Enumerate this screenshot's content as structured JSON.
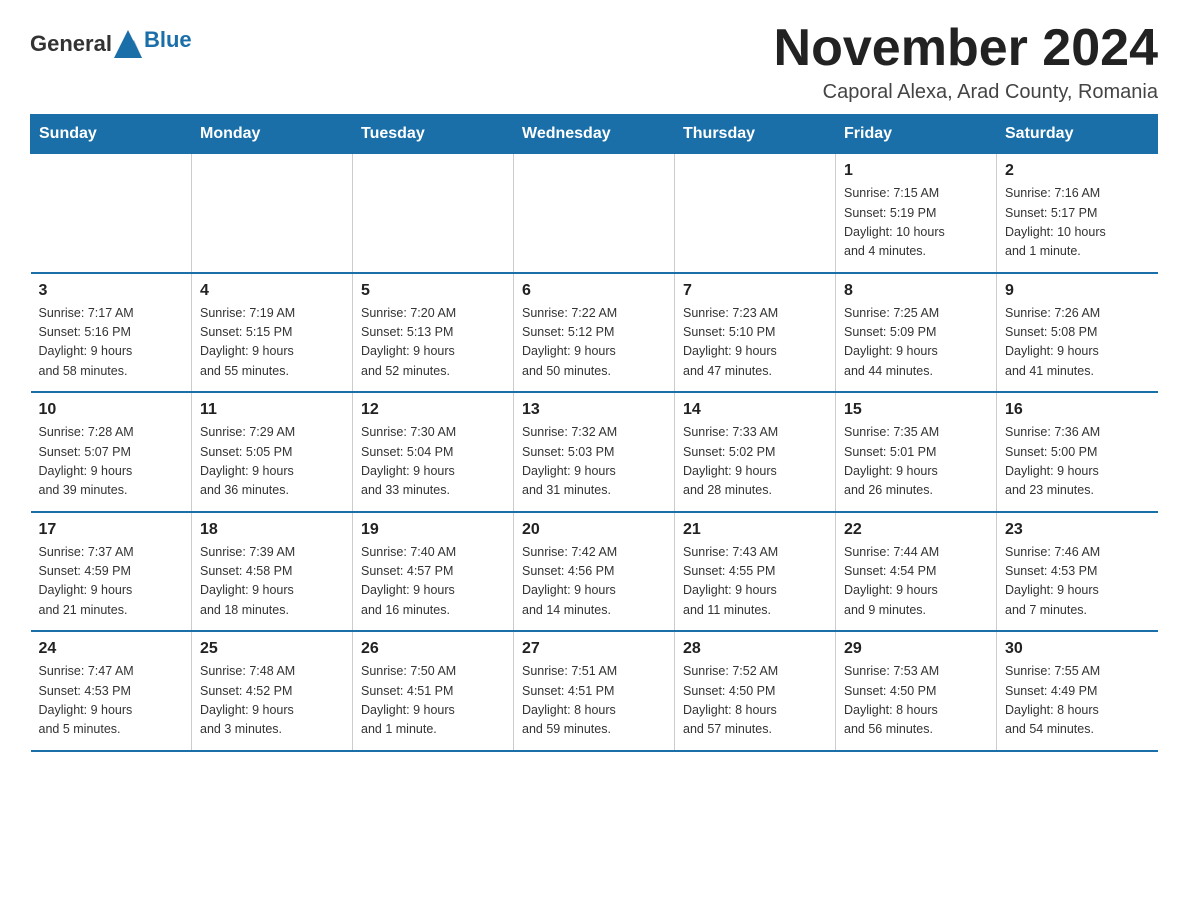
{
  "header": {
    "logo_general": "General",
    "logo_blue": "Blue",
    "month_title": "November 2024",
    "location": "Caporal Alexa, Arad County, Romania"
  },
  "weekdays": [
    "Sunday",
    "Monday",
    "Tuesday",
    "Wednesday",
    "Thursday",
    "Friday",
    "Saturday"
  ],
  "weeks": [
    [
      {
        "day": "",
        "info": ""
      },
      {
        "day": "",
        "info": ""
      },
      {
        "day": "",
        "info": ""
      },
      {
        "day": "",
        "info": ""
      },
      {
        "day": "",
        "info": ""
      },
      {
        "day": "1",
        "info": "Sunrise: 7:15 AM\nSunset: 5:19 PM\nDaylight: 10 hours\nand 4 minutes."
      },
      {
        "day": "2",
        "info": "Sunrise: 7:16 AM\nSunset: 5:17 PM\nDaylight: 10 hours\nand 1 minute."
      }
    ],
    [
      {
        "day": "3",
        "info": "Sunrise: 7:17 AM\nSunset: 5:16 PM\nDaylight: 9 hours\nand 58 minutes."
      },
      {
        "day": "4",
        "info": "Sunrise: 7:19 AM\nSunset: 5:15 PM\nDaylight: 9 hours\nand 55 minutes."
      },
      {
        "day": "5",
        "info": "Sunrise: 7:20 AM\nSunset: 5:13 PM\nDaylight: 9 hours\nand 52 minutes."
      },
      {
        "day": "6",
        "info": "Sunrise: 7:22 AM\nSunset: 5:12 PM\nDaylight: 9 hours\nand 50 minutes."
      },
      {
        "day": "7",
        "info": "Sunrise: 7:23 AM\nSunset: 5:10 PM\nDaylight: 9 hours\nand 47 minutes."
      },
      {
        "day": "8",
        "info": "Sunrise: 7:25 AM\nSunset: 5:09 PM\nDaylight: 9 hours\nand 44 minutes."
      },
      {
        "day": "9",
        "info": "Sunrise: 7:26 AM\nSunset: 5:08 PM\nDaylight: 9 hours\nand 41 minutes."
      }
    ],
    [
      {
        "day": "10",
        "info": "Sunrise: 7:28 AM\nSunset: 5:07 PM\nDaylight: 9 hours\nand 39 minutes."
      },
      {
        "day": "11",
        "info": "Sunrise: 7:29 AM\nSunset: 5:05 PM\nDaylight: 9 hours\nand 36 minutes."
      },
      {
        "day": "12",
        "info": "Sunrise: 7:30 AM\nSunset: 5:04 PM\nDaylight: 9 hours\nand 33 minutes."
      },
      {
        "day": "13",
        "info": "Sunrise: 7:32 AM\nSunset: 5:03 PM\nDaylight: 9 hours\nand 31 minutes."
      },
      {
        "day": "14",
        "info": "Sunrise: 7:33 AM\nSunset: 5:02 PM\nDaylight: 9 hours\nand 28 minutes."
      },
      {
        "day": "15",
        "info": "Sunrise: 7:35 AM\nSunset: 5:01 PM\nDaylight: 9 hours\nand 26 minutes."
      },
      {
        "day": "16",
        "info": "Sunrise: 7:36 AM\nSunset: 5:00 PM\nDaylight: 9 hours\nand 23 minutes."
      }
    ],
    [
      {
        "day": "17",
        "info": "Sunrise: 7:37 AM\nSunset: 4:59 PM\nDaylight: 9 hours\nand 21 minutes."
      },
      {
        "day": "18",
        "info": "Sunrise: 7:39 AM\nSunset: 4:58 PM\nDaylight: 9 hours\nand 18 minutes."
      },
      {
        "day": "19",
        "info": "Sunrise: 7:40 AM\nSunset: 4:57 PM\nDaylight: 9 hours\nand 16 minutes."
      },
      {
        "day": "20",
        "info": "Sunrise: 7:42 AM\nSunset: 4:56 PM\nDaylight: 9 hours\nand 14 minutes."
      },
      {
        "day": "21",
        "info": "Sunrise: 7:43 AM\nSunset: 4:55 PM\nDaylight: 9 hours\nand 11 minutes."
      },
      {
        "day": "22",
        "info": "Sunrise: 7:44 AM\nSunset: 4:54 PM\nDaylight: 9 hours\nand 9 minutes."
      },
      {
        "day": "23",
        "info": "Sunrise: 7:46 AM\nSunset: 4:53 PM\nDaylight: 9 hours\nand 7 minutes."
      }
    ],
    [
      {
        "day": "24",
        "info": "Sunrise: 7:47 AM\nSunset: 4:53 PM\nDaylight: 9 hours\nand 5 minutes."
      },
      {
        "day": "25",
        "info": "Sunrise: 7:48 AM\nSunset: 4:52 PM\nDaylight: 9 hours\nand 3 minutes."
      },
      {
        "day": "26",
        "info": "Sunrise: 7:50 AM\nSunset: 4:51 PM\nDaylight: 9 hours\nand 1 minute."
      },
      {
        "day": "27",
        "info": "Sunrise: 7:51 AM\nSunset: 4:51 PM\nDaylight: 8 hours\nand 59 minutes."
      },
      {
        "day": "28",
        "info": "Sunrise: 7:52 AM\nSunset: 4:50 PM\nDaylight: 8 hours\nand 57 minutes."
      },
      {
        "day": "29",
        "info": "Sunrise: 7:53 AM\nSunset: 4:50 PM\nDaylight: 8 hours\nand 56 minutes."
      },
      {
        "day": "30",
        "info": "Sunrise: 7:55 AM\nSunset: 4:49 PM\nDaylight: 8 hours\nand 54 minutes."
      }
    ]
  ]
}
